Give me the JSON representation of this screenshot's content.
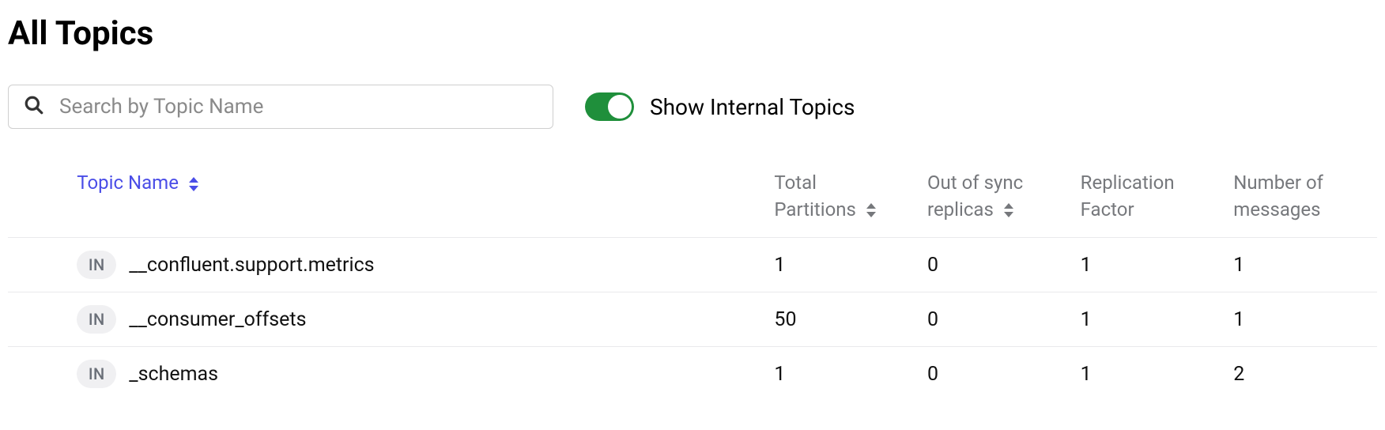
{
  "page_title": "All Topics",
  "search": {
    "placeholder": "Search by Topic Name"
  },
  "toggle": {
    "label": "Show Internal Topics",
    "on": true
  },
  "columns": {
    "name": "Topic Name",
    "total_partitions_l1": "Total",
    "total_partitions_l2": "Partitions",
    "out_of_sync_l1": "Out of sync",
    "out_of_sync_l2": "replicas",
    "replication_l1": "Replication",
    "replication_l2": "Factor",
    "messages_l1": "Number of",
    "messages_l2": "messages"
  },
  "rows": [
    {
      "badge": "IN",
      "name": "__confluent.support.metrics",
      "total_partitions": "1",
      "out_of_sync": "0",
      "replication": "1",
      "messages": "1"
    },
    {
      "badge": "IN",
      "name": "__consumer_offsets",
      "total_partitions": "50",
      "out_of_sync": "0",
      "replication": "1",
      "messages": "1"
    },
    {
      "badge": "IN",
      "name": "_schemas",
      "total_partitions": "1",
      "out_of_sync": "0",
      "replication": "1",
      "messages": "2"
    }
  ]
}
